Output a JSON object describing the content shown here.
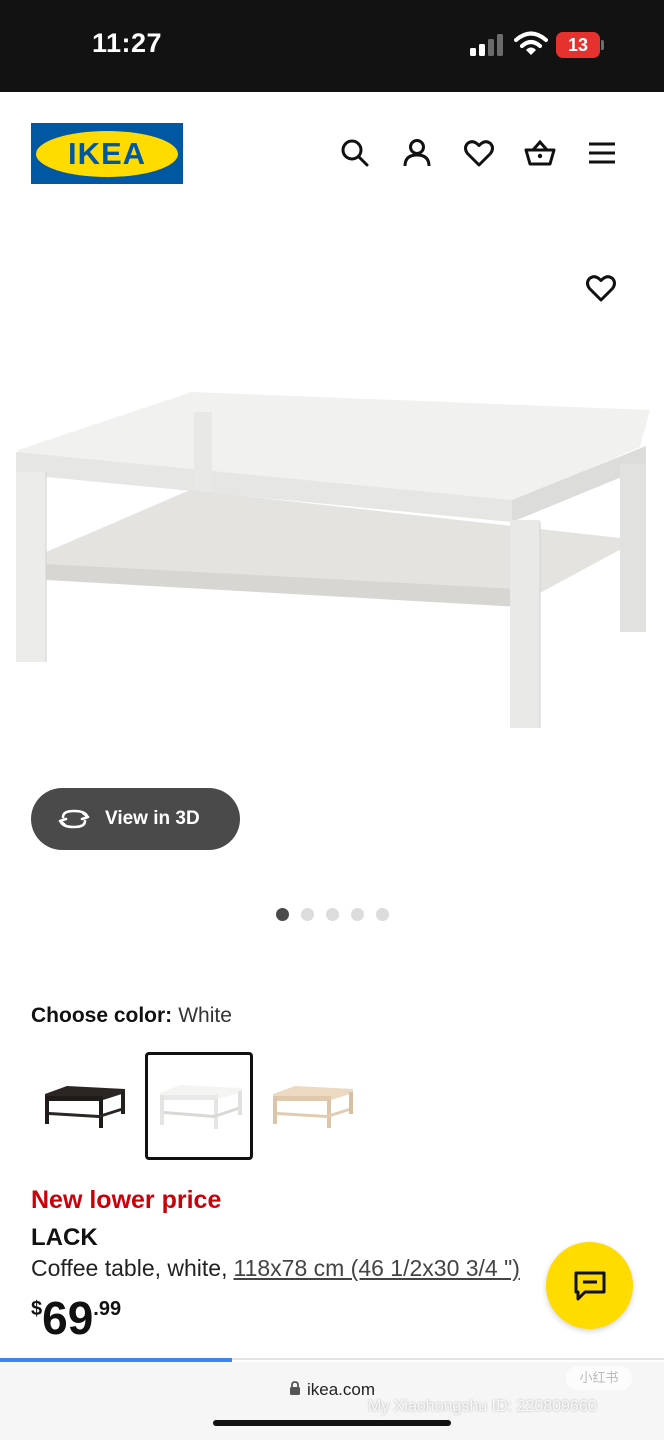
{
  "status_bar": {
    "time": "11:27",
    "battery_level": "13",
    "battery_color": "#e5322e",
    "icons": [
      "signal-icon",
      "wifi-icon",
      "battery-icon"
    ]
  },
  "header": {
    "logo_text": "IKEA",
    "brand_colors": {
      "blue": "#0058a3",
      "yellow": "#ffdb00"
    },
    "icons": [
      "search-icon",
      "user-icon",
      "heart-icon",
      "basket-icon",
      "menu-icon"
    ]
  },
  "gallery": {
    "view_3d_label": "View in 3D",
    "dots_total": 5,
    "active_dot": 1
  },
  "color_chooser": {
    "label": "Choose color:",
    "selected": "White",
    "swatches": [
      {
        "name": "black-brown",
        "selected": false
      },
      {
        "name": "white",
        "selected": true
      },
      {
        "name": "white-stained-oak",
        "selected": false
      }
    ]
  },
  "product": {
    "promo": "New lower price",
    "name": "LACK",
    "description": "Coffee table, white,",
    "measurement": "118x78 cm (46 1/2x30 3/4 \")",
    "price_currency": "$",
    "price_integer": "69",
    "price_decimal": ".99",
    "promo_color": "#cc0008"
  },
  "browser": {
    "url": "ikea.com",
    "load_progress": 0.35,
    "watermark": "My Xiaohongshu ID: 220809660",
    "watermark_badge": "小红书"
  }
}
